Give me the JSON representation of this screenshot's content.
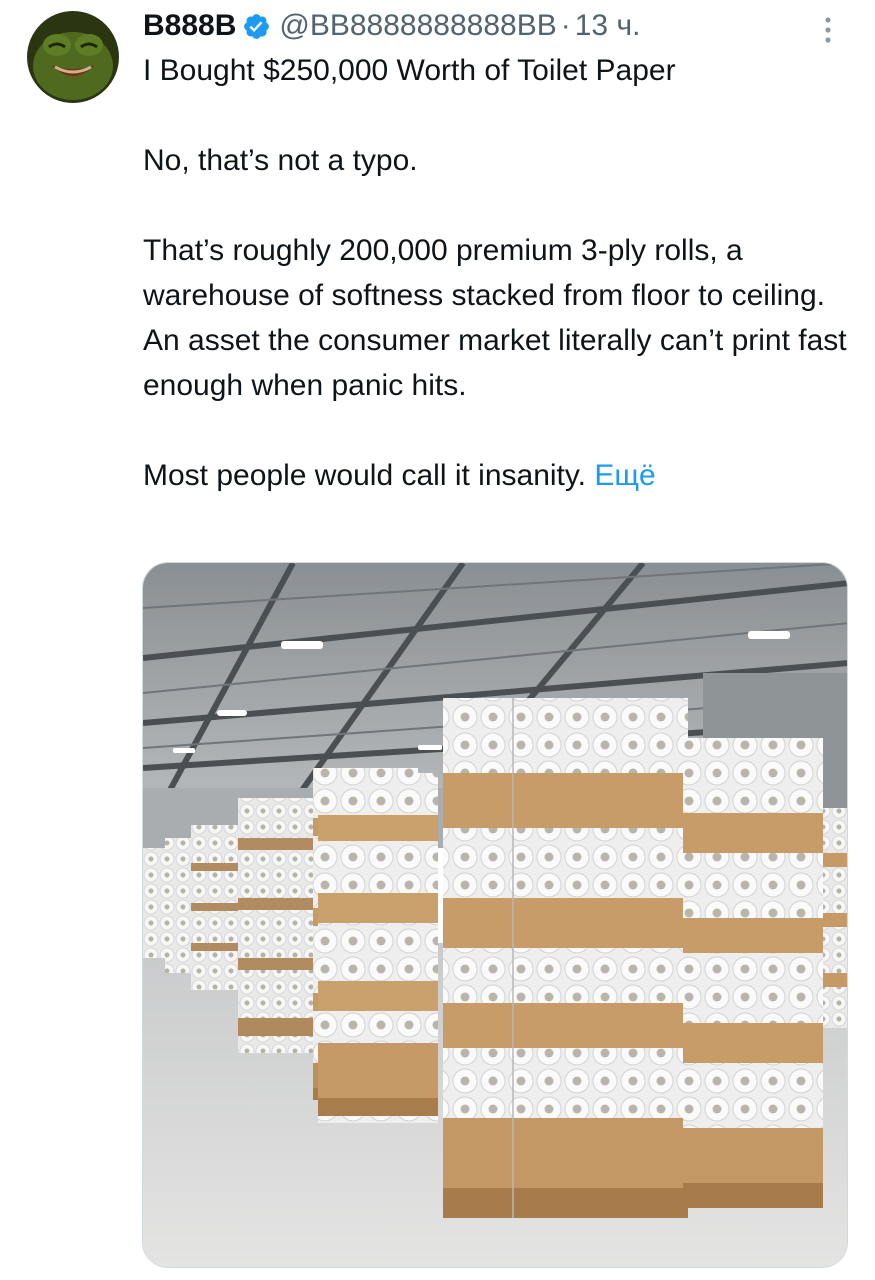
{
  "tweet": {
    "display_name": "B888B",
    "handle": "@BB8888888888BB",
    "separator": "·",
    "time": "13 ч.",
    "lines": {
      "title": "I Bought $250,000 Worth of Toilet Paper",
      "p2": "No, that’s not a typo.",
      "p3": "That’s roughly 200,000 premium 3-ply rolls, a warehouse of softness stacked from floor to ceiling. An asset the consumer market literally can’t print fast enough when panic hits.",
      "p4": "Most people would call it insanity."
    },
    "more_label": "Ещё"
  },
  "icons": {
    "verified": "verified-badge-icon",
    "more": "vertical-ellipsis-icon"
  },
  "colors": {
    "link": "#1d9bf0",
    "secondary_text": "#536471",
    "verified": "#1d9bf0",
    "avatar_bg": "#2b3a12"
  }
}
